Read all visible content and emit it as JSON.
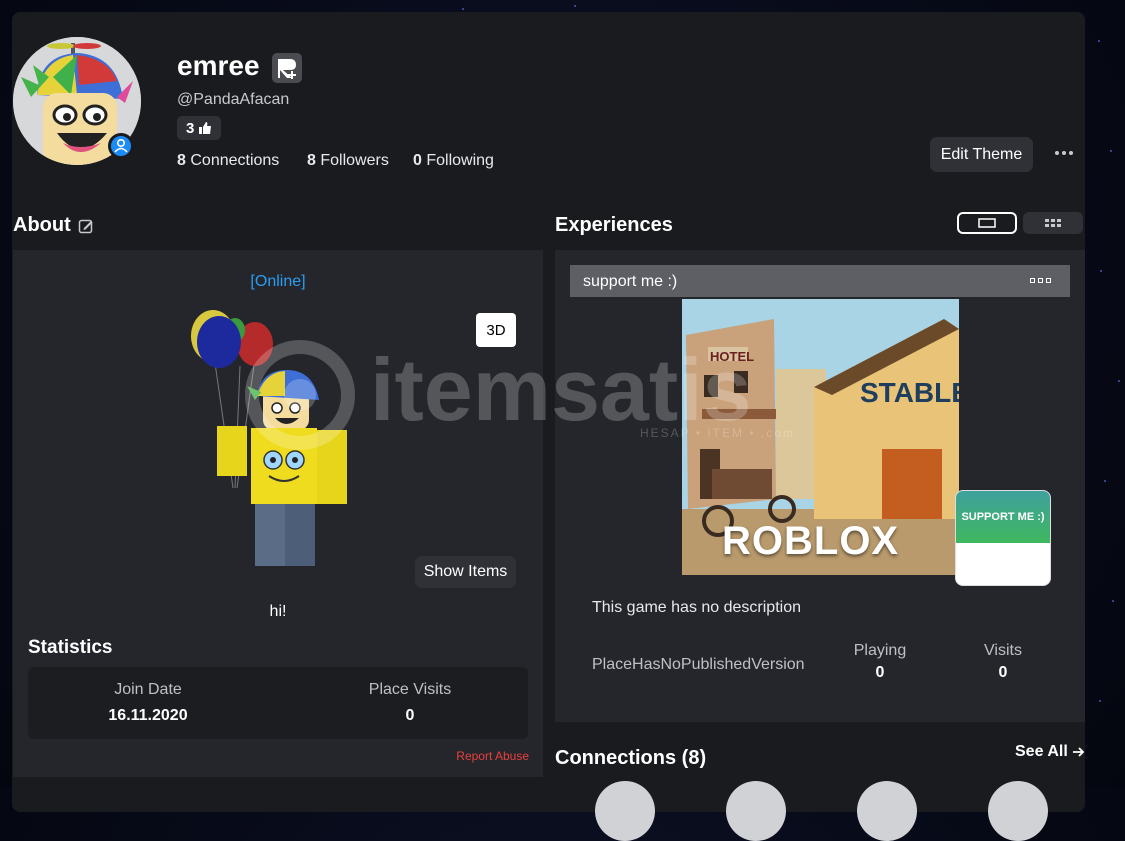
{
  "profile": {
    "display_name": "emree",
    "username": "@PandaAfacan",
    "likes": "3",
    "connections_count": "8",
    "connections_label": "Connections",
    "followers_count": "8",
    "followers_label": "Followers",
    "following_count": "0",
    "following_label": "Following",
    "edit_theme": "Edit Theme"
  },
  "about": {
    "title": "About",
    "status": "[Online]",
    "btn_3d": "3D",
    "show_items": "Show Items",
    "bio": "hi!"
  },
  "statistics": {
    "title": "Statistics",
    "join_label": "Join Date",
    "join_value": "16.11.2020",
    "visits_label": "Place Visits",
    "visits_value": "0",
    "report": "Report Abuse"
  },
  "experiences": {
    "title": "Experiences",
    "game_title": "support me :)",
    "thumb_text": "ROBLOX",
    "sign_hotel": "HOTEL",
    "sign_stable": "STABLE",
    "icon_text": "SUPPORT ME :)",
    "description": "This game has no description",
    "version": "PlaceHasNoPublishedVersion",
    "playing_label": "Playing",
    "playing_value": "0",
    "visits_label": "Visits",
    "visits_value": "0"
  },
  "connections": {
    "title": "Connections (8)",
    "see_all": "See All"
  },
  "watermark": {
    "text": "itemsatis",
    "sub": "HESAP • ITEM • .com"
  },
  "colors": {
    "accent_blue": "#1d8bf5",
    "report_red": "#e8403e"
  }
}
